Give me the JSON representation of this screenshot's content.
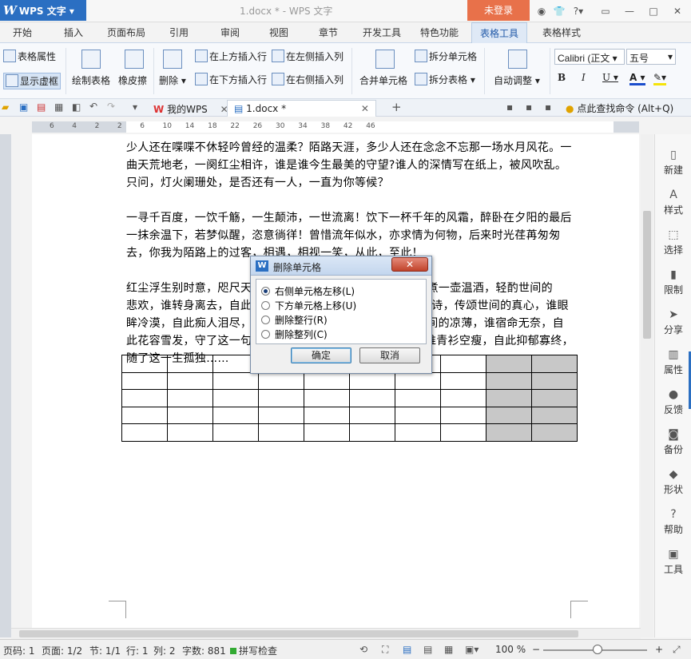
{
  "titlebar": {
    "app_name": "WPS 文字",
    "doc_title": "1.docx * - WPS 文字",
    "login": "未登录"
  },
  "menu": [
    "开始",
    "插入",
    "页面布局",
    "引用",
    "审阅",
    "视图",
    "章节",
    "开发工具",
    "特色功能",
    "表格工具",
    "表格样式"
  ],
  "ribbon": {
    "table_props": "表格属性",
    "show_gridlines": "显示虚框",
    "draw_table": "绘制表格",
    "eraser": "橡皮擦",
    "delete": "删除",
    "insert_above": "在上方插入行",
    "insert_below": "在下方插入行",
    "insert_left": "在左侧插入列",
    "insert_right": "在右侧插入列",
    "merge_cells": "合并单元格",
    "split_cells": "拆分单元格",
    "split_table": "拆分表格",
    "auto_fit": "自动调整",
    "font": "Calibri (正文",
    "font_size": "五号"
  },
  "quickbar": {
    "tab1": "我的WPS",
    "tab2": "1.docx *",
    "search": "点此查找命令 (Alt+Q)"
  },
  "ruler_numbers": [
    "6",
    "4",
    "2",
    "2",
    "6",
    "10",
    "14",
    "18",
    "22",
    "26",
    "30",
    "34",
    "38",
    "42",
    "46"
  ],
  "document": {
    "p1": "少人还在喋喋不休轻吟曾经的温柔？陌路天涯，多少人还在念念不忘那一场水月风花。一曲天荒地老，一阕红尘相许，谁是谁今生最美的守望?谁人的深情写在纸上，被风吹乱。只问，灯火阑珊处，是否还有一人，一直为你等候？",
    "p2": "一寻千百度，一饮千觞，一生颠沛，一世流离！饮下一杯千年的风霜，醉卧在夕阳的最后一抹余温下，若梦似醒，恣意徜徉！曾惜流年似水，亦求情为何物，后来时光荏苒匆匆去，你我为陌路上的过客，相遇，相视一笑，从此，至此！",
    "p3a": "红尘浮生别时意，咫尺天",
    "p3b": "影。煮一壶温酒，轻酌世间的",
    "p3c": "悲欢，谁转身离去，自此",
    "p3d": "情诗，传颂世间的真心，谁眼",
    "p3e": "眸冷漠，自此痴人泪尽，",
    "p3f": "世间的凉薄，谁宿命无奈，自",
    "p3g": "此花容雪发，守了这一句",
    "p3h": "谁青衫空瘦，自此抑郁寡终，",
    "p3i": "随了这一生孤独……"
  },
  "sidebar": [
    "新建",
    "样式",
    "选择",
    "限制",
    "分享",
    "属性",
    "反馈",
    "备份",
    "形状",
    "帮助",
    "工具"
  ],
  "status": {
    "page_code": "页码: 1",
    "page": "页面: 1/2",
    "section": "节: 1/1",
    "row": "行: 1",
    "col": "列: 2",
    "words": "字数: 881",
    "spell": "拼写检查",
    "zoom": "100 %"
  },
  "dialog": {
    "title": "删除单元格",
    "options": [
      "右侧单元格左移(L)",
      "下方单元格上移(U)",
      "删除整行(R)",
      "删除整列(C)"
    ],
    "selected": 0,
    "ok": "确定",
    "cancel": "取消"
  },
  "colors": {
    "accent": "#2b6fc2",
    "login_bg": "#e8714a",
    "grey_cells": "#c8c8c8"
  }
}
